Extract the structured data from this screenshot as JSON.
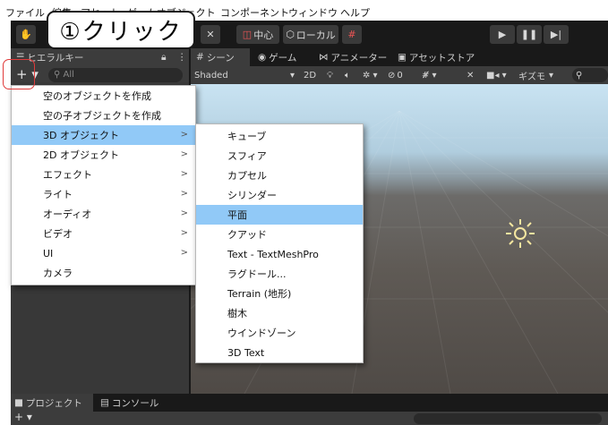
{
  "menubar": {
    "items": [
      "ファイル",
      "編集",
      "アセット",
      "ゲームオブジェクト",
      "コンポーネント",
      "ウィンドウ",
      "ヘルプ"
    ]
  },
  "callout": {
    "text": "①クリック"
  },
  "toolbar": {
    "pivot_label": "中心",
    "space_label": "ローカル"
  },
  "tabs": {
    "hierarchy": "ヒエラルキー",
    "scene": "シーン",
    "game": "ゲーム",
    "animator": "アニメーター",
    "asset_store": "アセットストア"
  },
  "hierarchy": {
    "add_button": "+ ▾",
    "search_placeholder": "All"
  },
  "scene_toolbar": {
    "shading": "Shaded",
    "mode_2d": "2D",
    "hidden_count": "0",
    "gizmos": "ギズモ"
  },
  "context_menu": {
    "items": [
      {
        "label": "空のオブジェクトを作成",
        "arrow": ""
      },
      {
        "label": "空の子オブジェクトを作成",
        "arrow": ""
      },
      {
        "label": "3D オブジェクト",
        "arrow": ">"
      },
      {
        "label": "2D オブジェクト",
        "arrow": ">"
      },
      {
        "label": "エフェクト",
        "arrow": ">"
      },
      {
        "label": "ライト",
        "arrow": ">"
      },
      {
        "label": "オーディオ",
        "arrow": ">"
      },
      {
        "label": "ビデオ",
        "arrow": ">"
      },
      {
        "label": "UI",
        "arrow": ">"
      },
      {
        "label": "カメラ",
        "arrow": ""
      }
    ]
  },
  "submenu": {
    "items": [
      "キューブ",
      "スフィア",
      "カプセル",
      "シリンダー",
      "平面",
      "クアッド",
      "Text - TextMeshPro",
      "ラグドール...",
      "Terrain (地形)",
      "樹木",
      "ウインドゾーン",
      "3D Text"
    ]
  },
  "bottom": {
    "project_tab": "プロジェクト",
    "console_tab": "コンソール",
    "add_button": "+ ▾"
  }
}
